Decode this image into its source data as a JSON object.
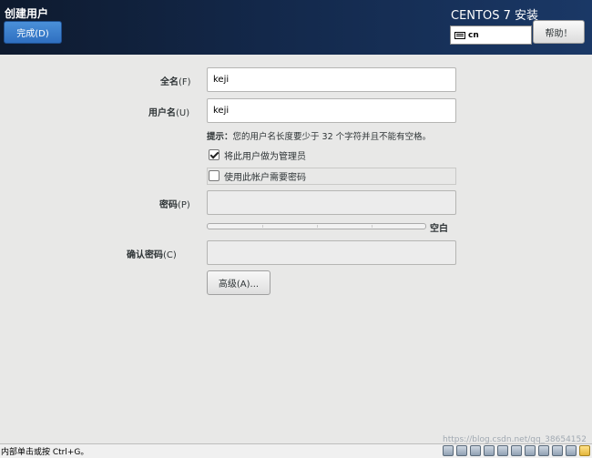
{
  "header": {
    "title": "创建用户",
    "done_button": "完成(D)",
    "product_title": "CENTOS 7 安装",
    "keyboard_layout": "cn",
    "help_button": "帮助！"
  },
  "form": {
    "fullname": {
      "label": "全名",
      "accel": "(F)",
      "value": "keji"
    },
    "username": {
      "label": "用户名",
      "accel": "(U)",
      "value": "keji"
    },
    "hint": {
      "prefix": "提示：",
      "text": "您的用户名长度要少于 32 个字符并且不能有空格。"
    },
    "admin_checkbox": {
      "label": "将此用户做为管理员",
      "checked": true
    },
    "require_password_checkbox": {
      "label": "使用此帐户需要密码",
      "checked": false
    },
    "password": {
      "label": "密码",
      "accel": "(P)",
      "value": ""
    },
    "strength": {
      "label": "空白",
      "level": 0
    },
    "confirm_password": {
      "label": "确认密码",
      "accel": "(C)",
      "value": ""
    },
    "advanced_button": "高级(A)..."
  },
  "statusbar": {
    "text": "内部单击或按 Ctrl+G。",
    "tray_icons": [
      "hdd-icon",
      "network-icon",
      "display-icon",
      "usb-icon",
      "printer-icon",
      "audio-icon",
      "cd-icon",
      "shared-folder-icon",
      "monitor-icon",
      "message-icon",
      "folder-icon"
    ]
  },
  "watermark": "https://blog.csdn.net/qq_38654152"
}
